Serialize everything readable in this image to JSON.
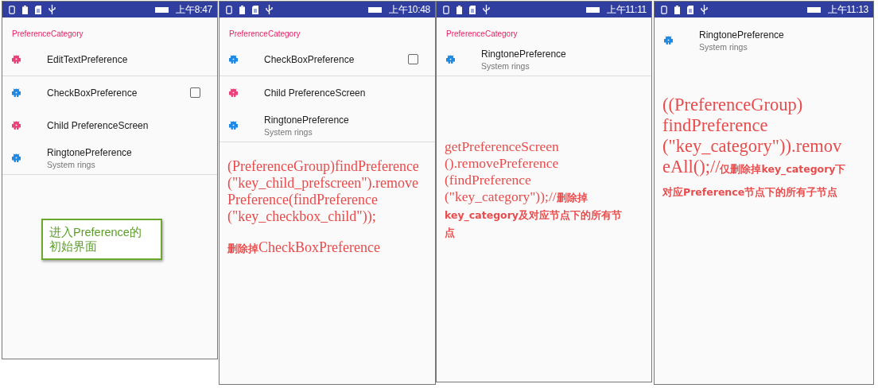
{
  "screens": [
    {
      "status_bar": {
        "time": "上午8:47"
      },
      "category": "PreferenceCategory",
      "preferences": [
        {
          "kind": "plain",
          "title": "EditTextPreference",
          "color": "#ec407a",
          "divider": true
        },
        {
          "kind": "checkbox",
          "title": "CheckBoxPreference",
          "checked": false,
          "color": "#1e88e5",
          "divider": false
        },
        {
          "kind": "plain",
          "title": "Child PreferenceScreen",
          "color": "#ec407a",
          "divider": false
        },
        {
          "kind": "plain",
          "title": "RingtonePreference",
          "summary": "System rings",
          "color": "#1e88e5",
          "divider": true
        }
      ],
      "note": {
        "kind": "callout",
        "text": "进入Preference的初始界面"
      }
    },
    {
      "status_bar": {
        "time": "上午10:48"
      },
      "category": "PreferenceCategory",
      "preferences": [
        {
          "kind": "checkbox",
          "title": "CheckBoxPreference",
          "checked": false,
          "color": "#1e88e5",
          "divider": true
        },
        {
          "kind": "plain",
          "title": "Child PreferenceScreen",
          "color": "#ec407a",
          "divider": false
        },
        {
          "kind": "plain",
          "title": "RingtonePreference",
          "summary": "System rings",
          "color": "#1e88e5",
          "divider": true
        }
      ],
      "note": {
        "kind": "code",
        "paragraphs": [
          [
            "(PreferenceGroup)findPreference",
            "(\"key_child_prefscreen\").remove",
            "Preference(findPreference",
            "(\"key_checkbox_child\"));"
          ],
          [
            "**删除掉**CheckBoxPreference"
          ]
        ]
      }
    },
    {
      "status_bar": {
        "time": "上午11:11"
      },
      "category": "PreferenceCategory",
      "preferences": [
        {
          "kind": "plain",
          "title": "RingtonePreference",
          "summary": "System rings",
          "color": "#1e88e5",
          "divider": true
        }
      ],
      "note": {
        "kind": "code",
        "paragraphs": [
          [
            "getPreferenceScreen",
            "().removePreference",
            "(findPreference",
            "(\"key_category\"));//**删除掉**",
            "**key_category及对应节点下的所有节**",
            "**点**"
          ]
        ]
      }
    },
    {
      "status_bar": {
        "time": "上午11:13"
      },
      "preferences": [
        {
          "kind": "plain",
          "title": "RingtonePreference",
          "summary": "System rings",
          "color": "#1e88e5",
          "divider": false
        }
      ],
      "note": {
        "kind": "code",
        "paragraphs": [
          [
            "((PreferenceGroup)",
            "findPreference",
            "(\"key_category\")).remov",
            "eAll();//**仅删除掉key_category下**",
            "**对应Preference节点下的所有子节点**"
          ]
        ]
      }
    }
  ]
}
